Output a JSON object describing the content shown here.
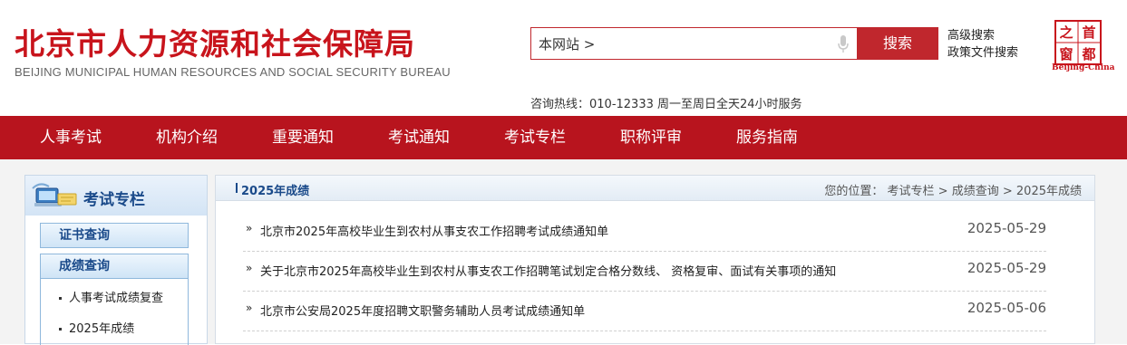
{
  "header": {
    "title_cn": "北京市人力资源和社会保障局",
    "title_en": "BEIJING MUNICIPAL HUMAN RESOURCES AND SOCIAL SECURITY BUREAU",
    "search_value": "本网站 >",
    "search_button": "搜索",
    "advanced_search": "高级搜索",
    "policy_search": "政策文件搜索",
    "seal_text": [
      "首",
      "都",
      "之",
      "窗"
    ],
    "seal_caption": "Beijing-China",
    "hotline": "咨询热线：010-12333 周一至周日全天24小时服务"
  },
  "nav": {
    "items": [
      {
        "label": "人事考试"
      },
      {
        "label": "机构介绍"
      },
      {
        "label": "重要通知"
      },
      {
        "label": "考试通知"
      },
      {
        "label": "考试专栏"
      },
      {
        "label": "职称评审"
      },
      {
        "label": "服务指南"
      }
    ]
  },
  "sidebar": {
    "title": "考试专栏",
    "items": [
      {
        "label": "证书查询"
      },
      {
        "label": "成绩查询"
      }
    ],
    "sub_items": [
      {
        "label": "人事考试成绩复查"
      },
      {
        "label": "2025年成绩"
      }
    ]
  },
  "main": {
    "title": "2025年成绩",
    "breadcrumb": {
      "prefix": "您的位置：",
      "crumbs": [
        "考试专栏",
        "成绩查询",
        "2025年成绩"
      ],
      "separator": ">"
    },
    "arrow": "»",
    "news": [
      {
        "title": "北京市2025年高校毕业生到农村从事支农工作招聘考试成绩通知单",
        "date": "2025-05-29"
      },
      {
        "title": "关于北京市2025年高校毕业生到农村从事支农工作招聘笔试划定合格分数线、 资格复审、面试有关事项的通知",
        "date": "2025-05-29"
      },
      {
        "title": "北京市公安局2025年度招聘文职警务辅助人员考试成绩通知单",
        "date": "2025-05-06"
      }
    ]
  },
  "colors": {
    "brand_red": "#c8141c",
    "nav_red": "#b8141e",
    "side_blue": "#1a4a8a"
  }
}
